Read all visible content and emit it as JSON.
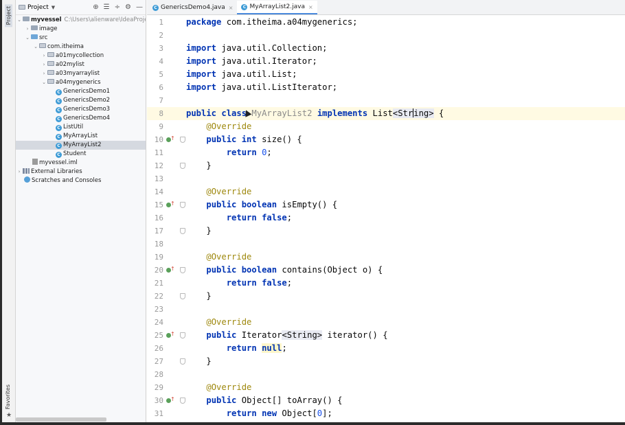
{
  "stripe": {
    "project_tab": "Project",
    "favorites_tab": "Favorites"
  },
  "project_panel": {
    "title": "Project",
    "root": {
      "name": "myvessel",
      "path": "C:\\Users\\alienware\\IdeaProjects\\"
    },
    "items": [
      {
        "label": "image",
        "type": "folder"
      },
      {
        "label": "src",
        "type": "folder-blue"
      },
      {
        "label": "com.itheima",
        "type": "pkg"
      },
      {
        "label": "a01mycollection",
        "type": "pkg"
      },
      {
        "label": "a02mylist",
        "type": "pkg"
      },
      {
        "label": "a03myarraylist",
        "type": "pkg"
      },
      {
        "label": "a04mygenerics",
        "type": "pkg"
      },
      {
        "label": "GenericsDemo1",
        "type": "class"
      },
      {
        "label": "GenericsDemo2",
        "type": "class"
      },
      {
        "label": "GenericsDemo3",
        "type": "class"
      },
      {
        "label": "GenericsDemo4",
        "type": "class"
      },
      {
        "label": "ListUtil",
        "type": "class"
      },
      {
        "label": "MyArrayList",
        "type": "class"
      },
      {
        "label": "MyArrayList2",
        "type": "class"
      },
      {
        "label": "Student",
        "type": "class"
      },
      {
        "label": "myvessel.iml",
        "type": "iml"
      },
      {
        "label": "External Libraries",
        "type": "lib"
      },
      {
        "label": "Scratches and Consoles",
        "type": "scratch"
      }
    ]
  },
  "tabs": [
    {
      "label": "GenericsDemo4.java"
    },
    {
      "label": "MyArrayList2.java"
    }
  ],
  "code": {
    "package": "com.itheima.a04mygenerics;",
    "imports": [
      "java.util.Collection;",
      "java.util.Iterator;",
      "java.util.List;",
      "java.util.ListIterator;"
    ],
    "class_name": "MyArrayList2",
    "annotation": "@Override",
    "line_numbers": [
      "1",
      "2",
      "3",
      "4",
      "5",
      "6",
      "7",
      "8",
      "9",
      "10",
      "11",
      "12",
      "13",
      "14",
      "15",
      "16",
      "17",
      "18",
      "19",
      "20",
      "21",
      "22",
      "23",
      "24",
      "25",
      "26",
      "27",
      "28",
      "29",
      "30",
      "31"
    ]
  },
  "colors": {
    "keyword": "#0033b3",
    "annotation": "#9e880d",
    "number": "#1750eb",
    "accent": "#4a89dc",
    "current_line": "#fffae3"
  }
}
